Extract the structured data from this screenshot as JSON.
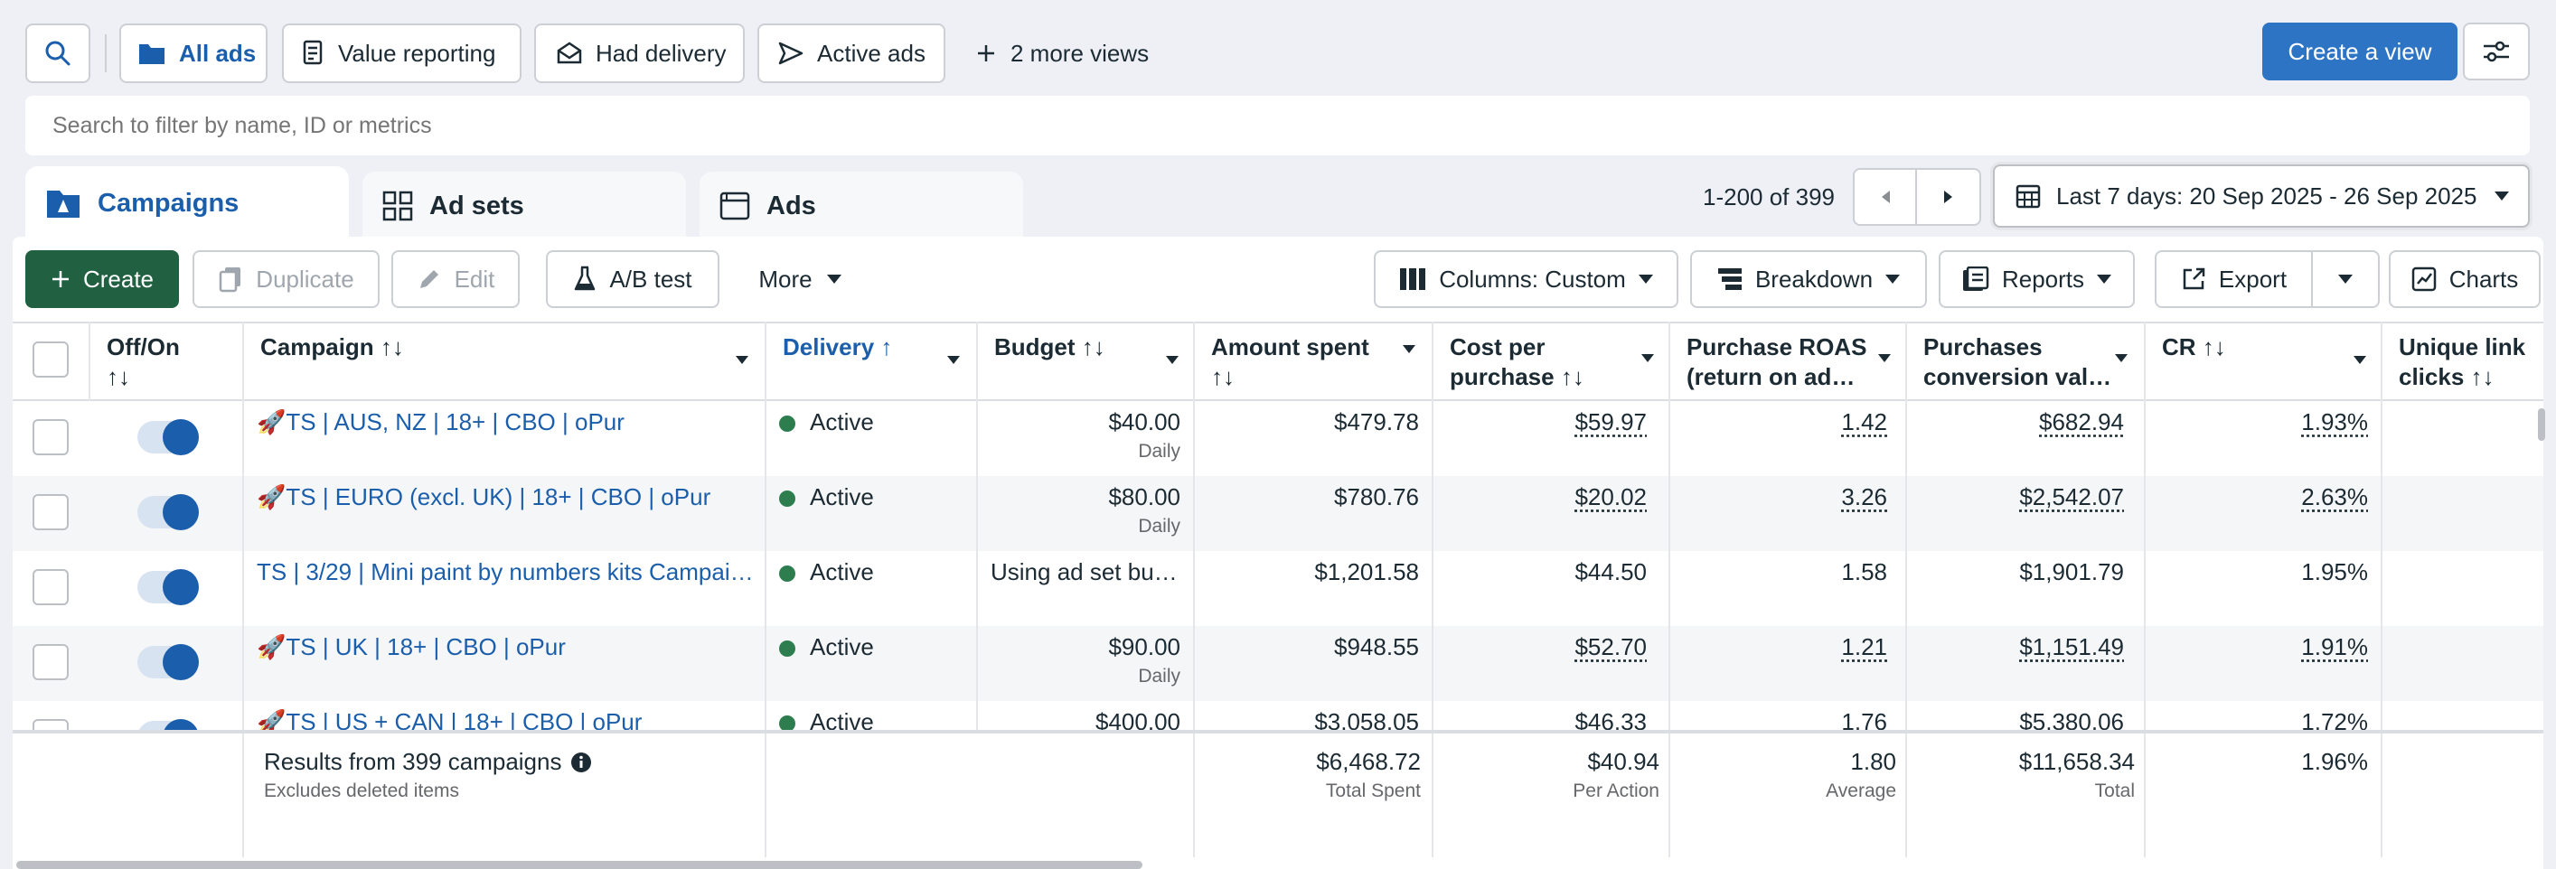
{
  "views": {
    "all_ads": "All ads",
    "value_reporting": "Value reporting",
    "had_delivery": "Had delivery",
    "active_ads": "Active ads",
    "more_views": "2 more views",
    "create_view": "Create a view"
  },
  "search": {
    "placeholder": "Search to filter by name, ID or metrics"
  },
  "tabs": {
    "campaigns": "Campaigns",
    "ad_sets": "Ad sets",
    "ads": "Ads"
  },
  "pagination": {
    "range": "1-200 of 399"
  },
  "date_range": "Last 7 days: 20 Sep 2025 - 26 Sep 2025",
  "toolbar": {
    "create": "Create",
    "duplicate": "Duplicate",
    "edit": "Edit",
    "ab_test": "A/B test",
    "more": "More",
    "columns": "Columns: Custom",
    "breakdown": "Breakdown",
    "reports": "Reports",
    "export": "Export",
    "charts": "Charts"
  },
  "columns": {
    "off_on": "Off/On",
    "campaign": "Campaign",
    "delivery": "Delivery",
    "budget": "Budget",
    "amount_spent": "Amount spent",
    "cost_per_purchase_1": "Cost per",
    "cost_per_purchase_2": "purchase",
    "roas_1": "Purchase ROAS",
    "roas_2": "(return on ad…",
    "conv_1": "Purchases",
    "conv_2": "conversion val…",
    "cr": "CR",
    "unique_1": "Unique link",
    "unique_2": "clicks"
  },
  "rows": [
    {
      "campaign": "🚀TS | AUS, NZ | 18+ | CBO | oPur",
      "delivery": "Active",
      "budget": "$40.00",
      "budget_type": "Daily",
      "spent": "$479.78",
      "cpp": "$59.97",
      "roas": "1.42",
      "conv": "$682.94",
      "cr": "1.93%"
    },
    {
      "campaign": "🚀TS | EURO (excl. UK) | 18+ | CBO | oPur",
      "delivery": "Active",
      "budget": "$80.00",
      "budget_type": "Daily",
      "spent": "$780.76",
      "cpp": "$20.02",
      "roas": "3.26",
      "conv": "$2,542.07",
      "cr": "2.63%"
    },
    {
      "campaign": "TS | 3/29 | Mini paint by numbers kits Campai…",
      "delivery": "Active",
      "budget": "Using ad set bu…",
      "budget_type": "",
      "spent": "$1,201.58",
      "cpp": "$44.50",
      "roas": "1.58",
      "conv": "$1,901.79",
      "cr": "1.95%"
    },
    {
      "campaign": "🚀TS | UK | 18+ | CBO | oPur",
      "delivery": "Active",
      "budget": "$90.00",
      "budget_type": "Daily",
      "spent": "$948.55",
      "cpp": "$52.70",
      "roas": "1.21",
      "conv": "$1,151.49",
      "cr": "1.91%"
    },
    {
      "campaign": "🚀TS | US + CAN | 18+ | CBO | oPur",
      "delivery": "Active",
      "budget": "$400.00",
      "budget_type": "",
      "spent": "$3,058.05",
      "cpp": "$46.33",
      "roas": "1.76",
      "conv": "$5,380.06",
      "cr": "1.72%"
    }
  ],
  "totals": {
    "label": "Results from 399 campaigns",
    "note": "Excludes deleted items",
    "spent": "$6,468.72",
    "spent_sub": "Total Spent",
    "cpp": "$40.94",
    "cpp_sub": "Per Action",
    "roas": "1.80",
    "roas_sub": "Average",
    "conv": "$11,658.34",
    "conv_sub": "Total",
    "cr": "1.96%"
  }
}
